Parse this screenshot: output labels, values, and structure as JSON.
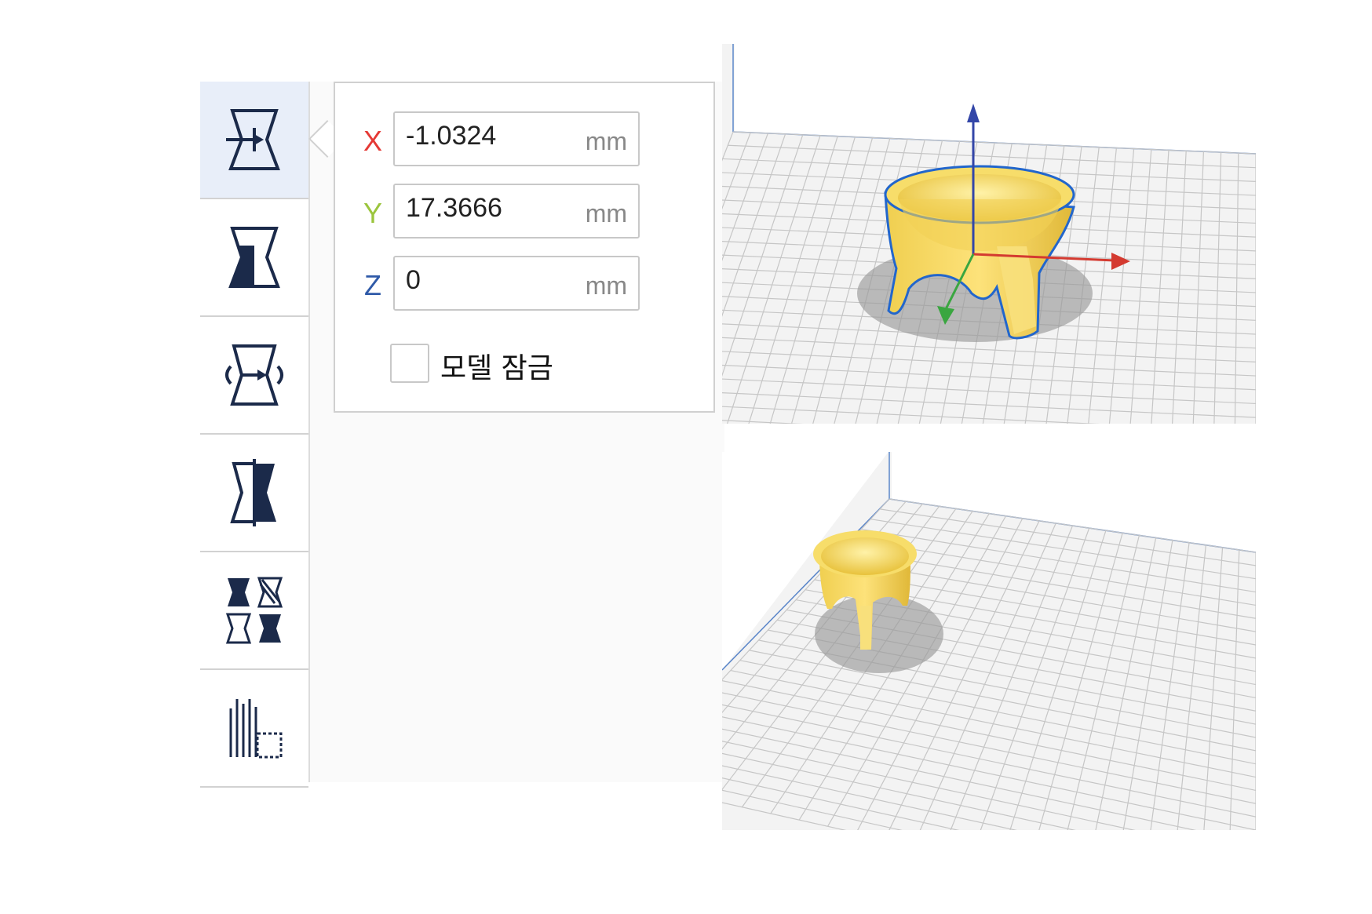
{
  "toolbar": {
    "tools": [
      {
        "name": "move-tool",
        "icon": "move-icon",
        "active": true
      },
      {
        "name": "scale-tool",
        "icon": "scale-icon",
        "active": false
      },
      {
        "name": "rotate-tool",
        "icon": "rotate-icon",
        "active": false
      },
      {
        "name": "mirror-tool",
        "icon": "mirror-icon",
        "active": false
      },
      {
        "name": "per-model-settings-tool",
        "icon": "per-model-settings-icon",
        "active": false
      },
      {
        "name": "support-blocker-tool",
        "icon": "support-blocker-icon",
        "active": false
      }
    ]
  },
  "move_panel": {
    "x": {
      "label": "X",
      "value": "-1.0324",
      "unit": "mm",
      "color": "#e53935"
    },
    "y": {
      "label": "Y",
      "value": "17.3666",
      "unit": "mm",
      "color": "#9bc53d"
    },
    "z": {
      "label": "Z",
      "value": "0",
      "unit": "mm",
      "color": "#2f5aa8"
    },
    "lock_model": {
      "label": "모델 잠금",
      "checked": false
    }
  },
  "viewports": {
    "top": {
      "model": "bowl",
      "selected": true,
      "gizmo": "move-arrows"
    },
    "bottom": {
      "model": "bowl",
      "selected": false
    }
  },
  "colors": {
    "model": "#f5d35a",
    "selection_outline": "#2266cc",
    "grid_line": "#c8c8c8",
    "build_plate": "#f0f0f0"
  }
}
